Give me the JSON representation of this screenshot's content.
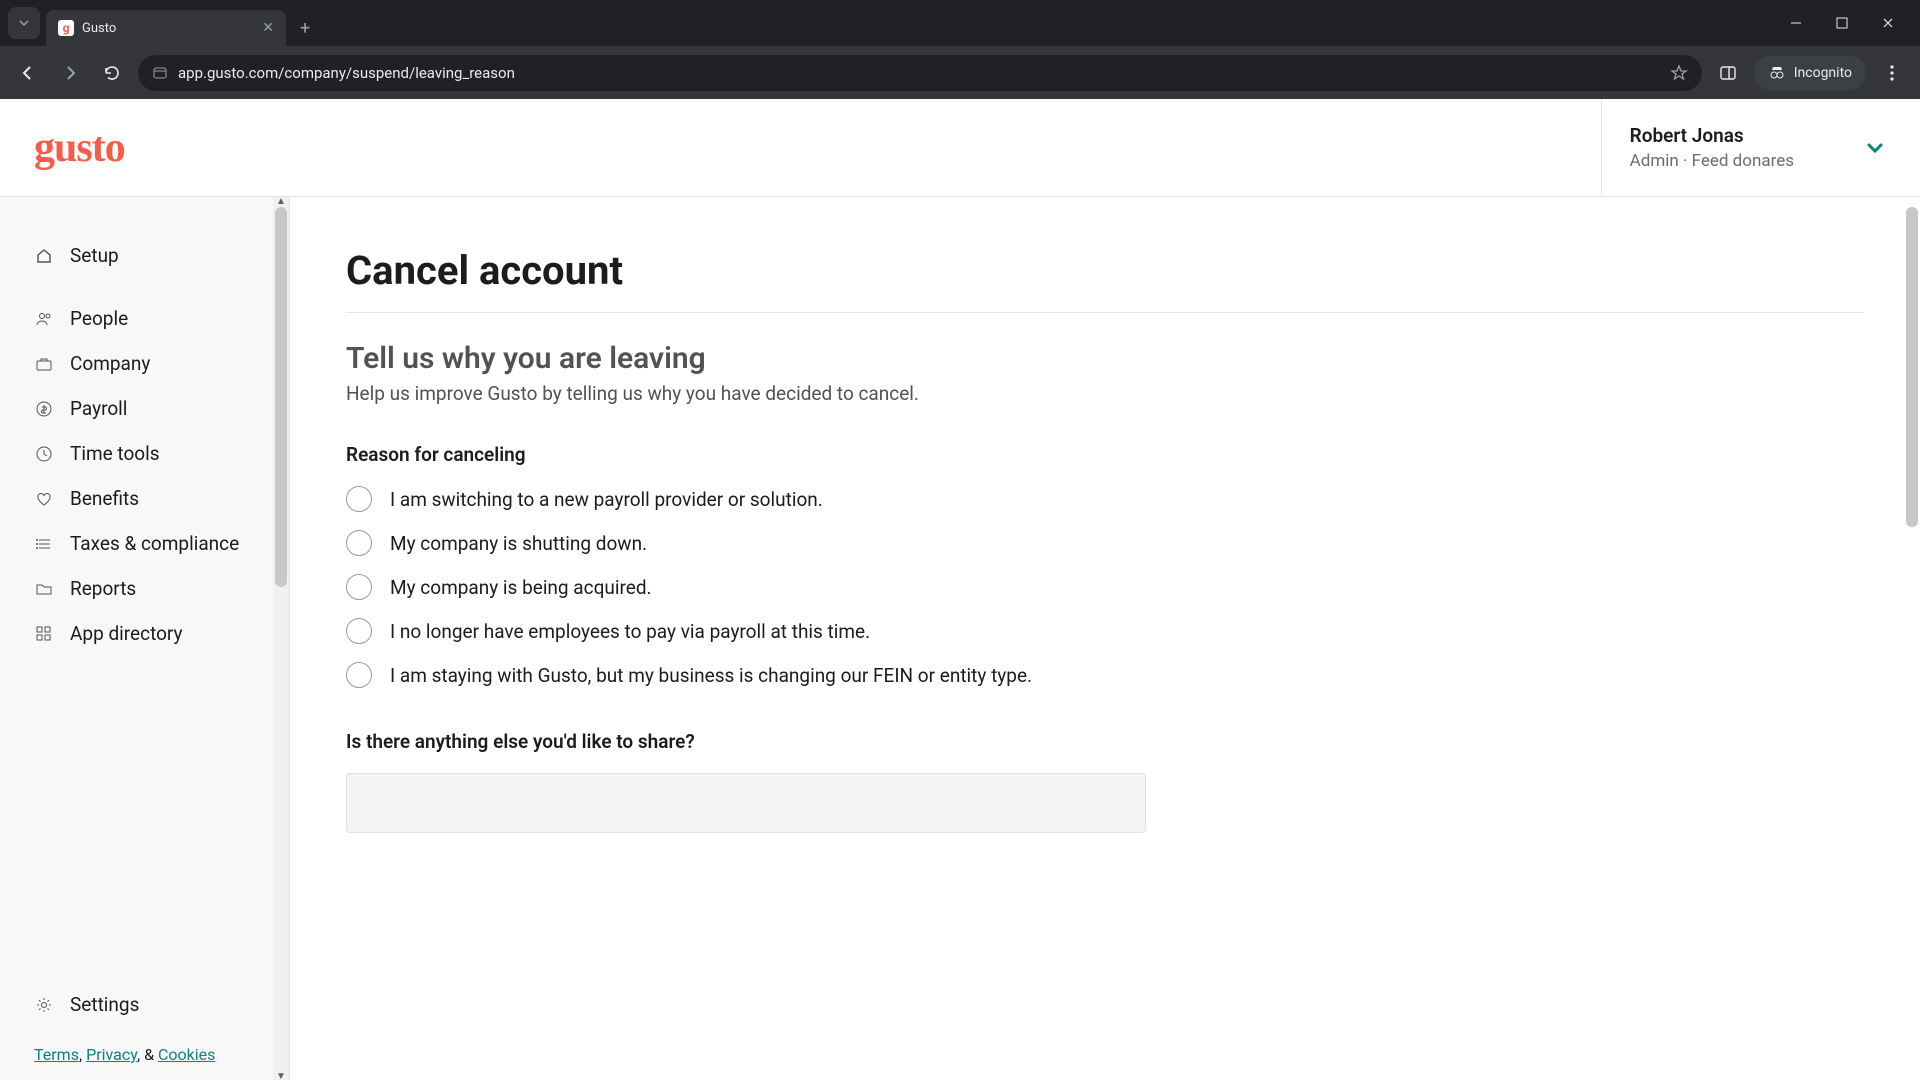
{
  "browser": {
    "tab_title": "Gusto",
    "url": "app.gusto.com/company/suspend/leaving_reason",
    "incognito_label": "Incognito"
  },
  "header": {
    "logo_text": "gusto",
    "user_name": "Robert Jonas",
    "user_role": "Admin · Feed donares"
  },
  "sidebar": {
    "items": [
      {
        "label": "Setup",
        "icon": "home"
      },
      {
        "label": "People",
        "icon": "people"
      },
      {
        "label": "Company",
        "icon": "briefcase"
      },
      {
        "label": "Payroll",
        "icon": "dollar"
      },
      {
        "label": "Time tools",
        "icon": "clock"
      },
      {
        "label": "Benefits",
        "icon": "heart"
      },
      {
        "label": "Taxes & compliance",
        "icon": "list"
      },
      {
        "label": "Reports",
        "icon": "folder"
      },
      {
        "label": "App directory",
        "icon": "grid"
      }
    ],
    "settings_label": "Settings",
    "footer": {
      "terms": "Terms",
      "privacy": "Privacy",
      "cookies": "Cookies",
      "sep1": ", ",
      "sep2": ", & "
    }
  },
  "main": {
    "title": "Cancel account",
    "subheading": "Tell us why you are leaving",
    "subtext": "Help us improve Gusto by telling us why you have decided to cancel.",
    "reason_label": "Reason for canceling",
    "options": [
      "I am switching to a new payroll provider or solution.",
      "My company is shutting down.",
      "My company is being acquired.",
      "I no longer have employees to pay via payroll at this time.",
      "I am staying with Gusto, but my business is changing our FEIN or entity type."
    ],
    "share_label": "Is there anything else you'd like to share?"
  }
}
